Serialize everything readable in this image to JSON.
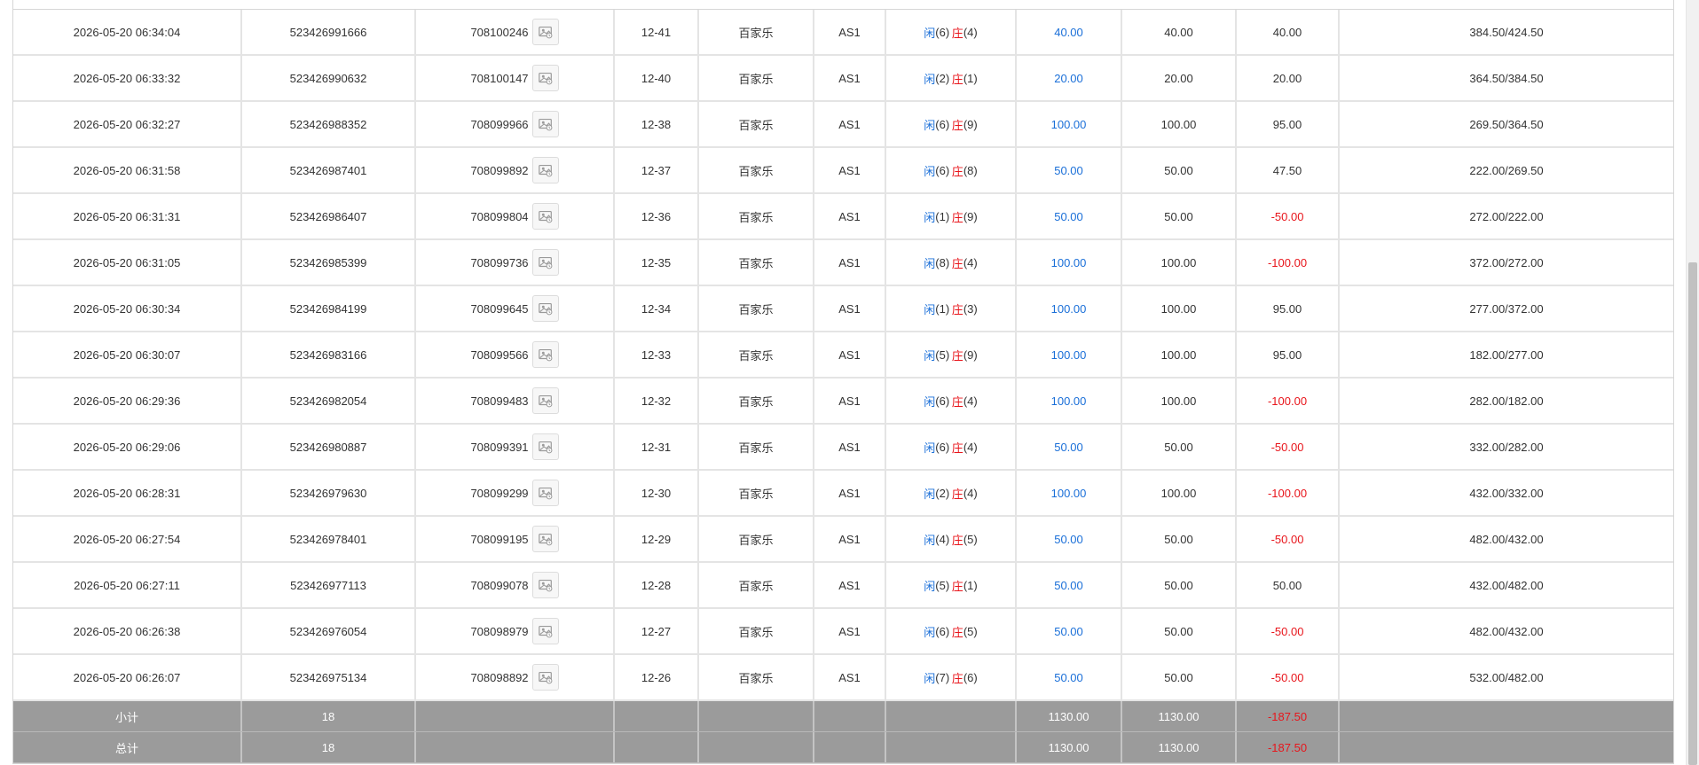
{
  "rows": [
    {
      "time": "2026-05-20 06:34:04",
      "order": "523426991666",
      "round": "708100246",
      "shoe": "12-41",
      "game": "百家乐",
      "table": "AS1",
      "result_player": "闲",
      "player_pts": "(6)",
      "result_banker": "庄",
      "banker_pts": "(4)",
      "bet": "40.00",
      "valid": "40.00",
      "win": "40.00",
      "win_neg": false,
      "balance": "384.50/424.50"
    },
    {
      "time": "2026-05-20 06:33:32",
      "order": "523426990632",
      "round": "708100147",
      "shoe": "12-40",
      "game": "百家乐",
      "table": "AS1",
      "result_player": "闲",
      "player_pts": "(2)",
      "result_banker": "庄",
      "banker_pts": "(1)",
      "bet": "20.00",
      "valid": "20.00",
      "win": "20.00",
      "win_neg": false,
      "balance": "364.50/384.50"
    },
    {
      "time": "2026-05-20 06:32:27",
      "order": "523426988352",
      "round": "708099966",
      "shoe": "12-38",
      "game": "百家乐",
      "table": "AS1",
      "result_player": "闲",
      "player_pts": "(6)",
      "result_banker": "庄",
      "banker_pts": "(9)",
      "bet": "100.00",
      "valid": "100.00",
      "win": "95.00",
      "win_neg": false,
      "balance": "269.50/364.50"
    },
    {
      "time": "2026-05-20 06:31:58",
      "order": "523426987401",
      "round": "708099892",
      "shoe": "12-37",
      "game": "百家乐",
      "table": "AS1",
      "result_player": "闲",
      "player_pts": "(6)",
      "result_banker": "庄",
      "banker_pts": "(8)",
      "bet": "50.00",
      "valid": "50.00",
      "win": "47.50",
      "win_neg": false,
      "balance": "222.00/269.50"
    },
    {
      "time": "2026-05-20 06:31:31",
      "order": "523426986407",
      "round": "708099804",
      "shoe": "12-36",
      "game": "百家乐",
      "table": "AS1",
      "result_player": "闲",
      "player_pts": "(1)",
      "result_banker": "庄",
      "banker_pts": "(9)",
      "bet": "50.00",
      "valid": "50.00",
      "win": "-50.00",
      "win_neg": true,
      "balance": "272.00/222.00"
    },
    {
      "time": "2026-05-20 06:31:05",
      "order": "523426985399",
      "round": "708099736",
      "shoe": "12-35",
      "game": "百家乐",
      "table": "AS1",
      "result_player": "闲",
      "player_pts": "(8)",
      "result_banker": "庄",
      "banker_pts": "(4)",
      "bet": "100.00",
      "valid": "100.00",
      "win": "-100.00",
      "win_neg": true,
      "balance": "372.00/272.00"
    },
    {
      "time": "2026-05-20 06:30:34",
      "order": "523426984199",
      "round": "708099645",
      "shoe": "12-34",
      "game": "百家乐",
      "table": "AS1",
      "result_player": "闲",
      "player_pts": "(1)",
      "result_banker": "庄",
      "banker_pts": "(3)",
      "bet": "100.00",
      "valid": "100.00",
      "win": "95.00",
      "win_neg": false,
      "balance": "277.00/372.00"
    },
    {
      "time": "2026-05-20 06:30:07",
      "order": "523426983166",
      "round": "708099566",
      "shoe": "12-33",
      "game": "百家乐",
      "table": "AS1",
      "result_player": "闲",
      "player_pts": "(5)",
      "result_banker": "庄",
      "banker_pts": "(9)",
      "bet": "100.00",
      "valid": "100.00",
      "win": "95.00",
      "win_neg": false,
      "balance": "182.00/277.00"
    },
    {
      "time": "2026-05-20 06:29:36",
      "order": "523426982054",
      "round": "708099483",
      "shoe": "12-32",
      "game": "百家乐",
      "table": "AS1",
      "result_player": "闲",
      "player_pts": "(6)",
      "result_banker": "庄",
      "banker_pts": "(4)",
      "bet": "100.00",
      "valid": "100.00",
      "win": "-100.00",
      "win_neg": true,
      "balance": "282.00/182.00"
    },
    {
      "time": "2026-05-20 06:29:06",
      "order": "523426980887",
      "round": "708099391",
      "shoe": "12-31",
      "game": "百家乐",
      "table": "AS1",
      "result_player": "闲",
      "player_pts": "(6)",
      "result_banker": "庄",
      "banker_pts": "(4)",
      "bet": "50.00",
      "valid": "50.00",
      "win": "-50.00",
      "win_neg": true,
      "balance": "332.00/282.00"
    },
    {
      "time": "2026-05-20 06:28:31",
      "order": "523426979630",
      "round": "708099299",
      "shoe": "12-30",
      "game": "百家乐",
      "table": "AS1",
      "result_player": "闲",
      "player_pts": "(2)",
      "result_banker": "庄",
      "banker_pts": "(4)",
      "bet": "100.00",
      "valid": "100.00",
      "win": "-100.00",
      "win_neg": true,
      "balance": "432.00/332.00"
    },
    {
      "time": "2026-05-20 06:27:54",
      "order": "523426978401",
      "round": "708099195",
      "shoe": "12-29",
      "game": "百家乐",
      "table": "AS1",
      "result_player": "闲",
      "player_pts": "(4)",
      "result_banker": "庄",
      "banker_pts": "(5)",
      "bet": "50.00",
      "valid": "50.00",
      "win": "-50.00",
      "win_neg": true,
      "balance": "482.00/432.00"
    },
    {
      "time": "2026-05-20 06:27:11",
      "order": "523426977113",
      "round": "708099078",
      "shoe": "12-28",
      "game": "百家乐",
      "table": "AS1",
      "result_player": "闲",
      "player_pts": "(5)",
      "result_banker": "庄",
      "banker_pts": "(1)",
      "bet": "50.00",
      "valid": "50.00",
      "win": "50.00",
      "win_neg": false,
      "balance": "432.00/482.00"
    },
    {
      "time": "2026-05-20 06:26:38",
      "order": "523426976054",
      "round": "708098979",
      "shoe": "12-27",
      "game": "百家乐",
      "table": "AS1",
      "result_player": "闲",
      "player_pts": "(6)",
      "result_banker": "庄",
      "banker_pts": "(5)",
      "bet": "50.00",
      "valid": "50.00",
      "win": "-50.00",
      "win_neg": true,
      "balance": "482.00/432.00"
    },
    {
      "time": "2026-05-20 06:26:07",
      "order": "523426975134",
      "round": "708098892",
      "shoe": "12-26",
      "game": "百家乐",
      "table": "AS1",
      "result_player": "闲",
      "player_pts": "(7)",
      "result_banker": "庄",
      "banker_pts": "(6)",
      "bet": "50.00",
      "valid": "50.00",
      "win": "-50.00",
      "win_neg": true,
      "balance": "532.00/482.00"
    }
  ],
  "subtotal": {
    "label": "小计",
    "count": "18",
    "bet": "1130.00",
    "valid": "1130.00",
    "win": "-187.50"
  },
  "total": {
    "label": "总计",
    "count": "18",
    "bet": "1130.00",
    "valid": "1130.00",
    "win": "-187.50"
  },
  "colors": {
    "player": "#1a6fd8",
    "banker": "#e8151b",
    "negative": "#e8151b",
    "summary_bg": "#9b9b9b"
  },
  "icons": {
    "round_detail": "photo-icon"
  }
}
